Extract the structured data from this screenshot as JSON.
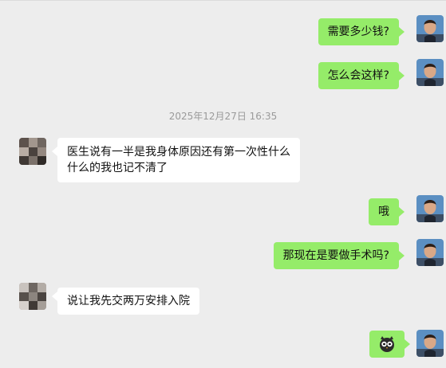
{
  "messages": [
    {
      "side": "right",
      "text": "需要多少钱?"
    },
    {
      "side": "right",
      "text": "怎么会这样?"
    },
    {
      "side": "left",
      "text": "医生说有一半是我身体原因还有第一次性什么什么的我也记不清了"
    },
    {
      "side": "right",
      "text": "哦"
    },
    {
      "side": "right",
      "text": "那现在是要做手术吗?"
    },
    {
      "side": "left",
      "text": "说让我先交两万安排入院"
    },
    {
      "side": "right",
      "type": "sticker",
      "sticker": "owl-emoji-icon"
    }
  ],
  "timestamp": "2025年12月27日 16:35",
  "colors": {
    "background": "#ededed",
    "sent_bubble": "#95ec69",
    "received_bubble": "#ffffff",
    "timestamp_text": "#9a9a9a"
  },
  "icons": {
    "sent_avatar": "user-avatar-photo",
    "received_avatar": "blurred-avatar-photo"
  }
}
